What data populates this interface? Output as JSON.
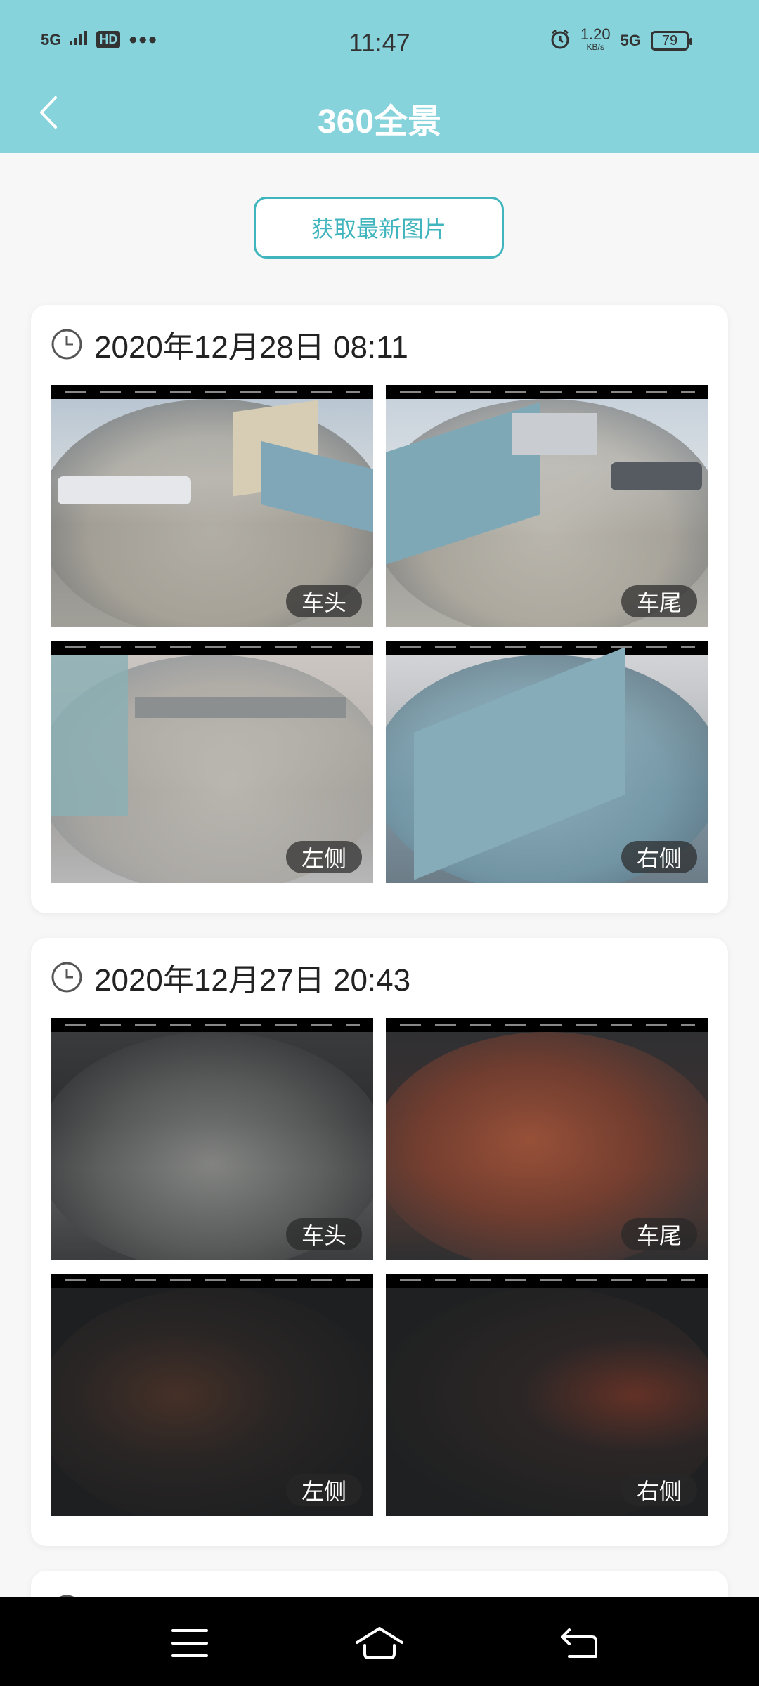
{
  "status_bar": {
    "network_left": "5G",
    "hd": "HD",
    "dots": "•••",
    "time": "11:47",
    "speed_value": "1.20",
    "speed_unit": "KB/s",
    "network_right": "5G",
    "battery": "79"
  },
  "header": {
    "title": "360全景",
    "back_icon": "chevron-left-icon"
  },
  "fetch_button": {
    "label": "获取最新图片"
  },
  "records": [
    {
      "datetime": "2020年12月28日 08:11",
      "photos": [
        {
          "label": "车头",
          "tone": "day"
        },
        {
          "label": "车尾",
          "tone": "day"
        },
        {
          "label": "左侧",
          "tone": "day"
        },
        {
          "label": "右侧",
          "tone": "day"
        }
      ]
    },
    {
      "datetime": "2020年12月27日 20:43",
      "photos": [
        {
          "label": "车头",
          "tone": "night"
        },
        {
          "label": "车尾",
          "tone": "night-red"
        },
        {
          "label": "左侧",
          "tone": "dark"
        },
        {
          "label": "右侧",
          "tone": "dark"
        }
      ]
    }
  ],
  "colors": {
    "header_bg": "#86d3dc",
    "accent": "#41b5bd"
  },
  "bottom_nav": {
    "menu_icon": "menu-icon",
    "home_icon": "home-icon",
    "back_icon": "return-icon"
  }
}
